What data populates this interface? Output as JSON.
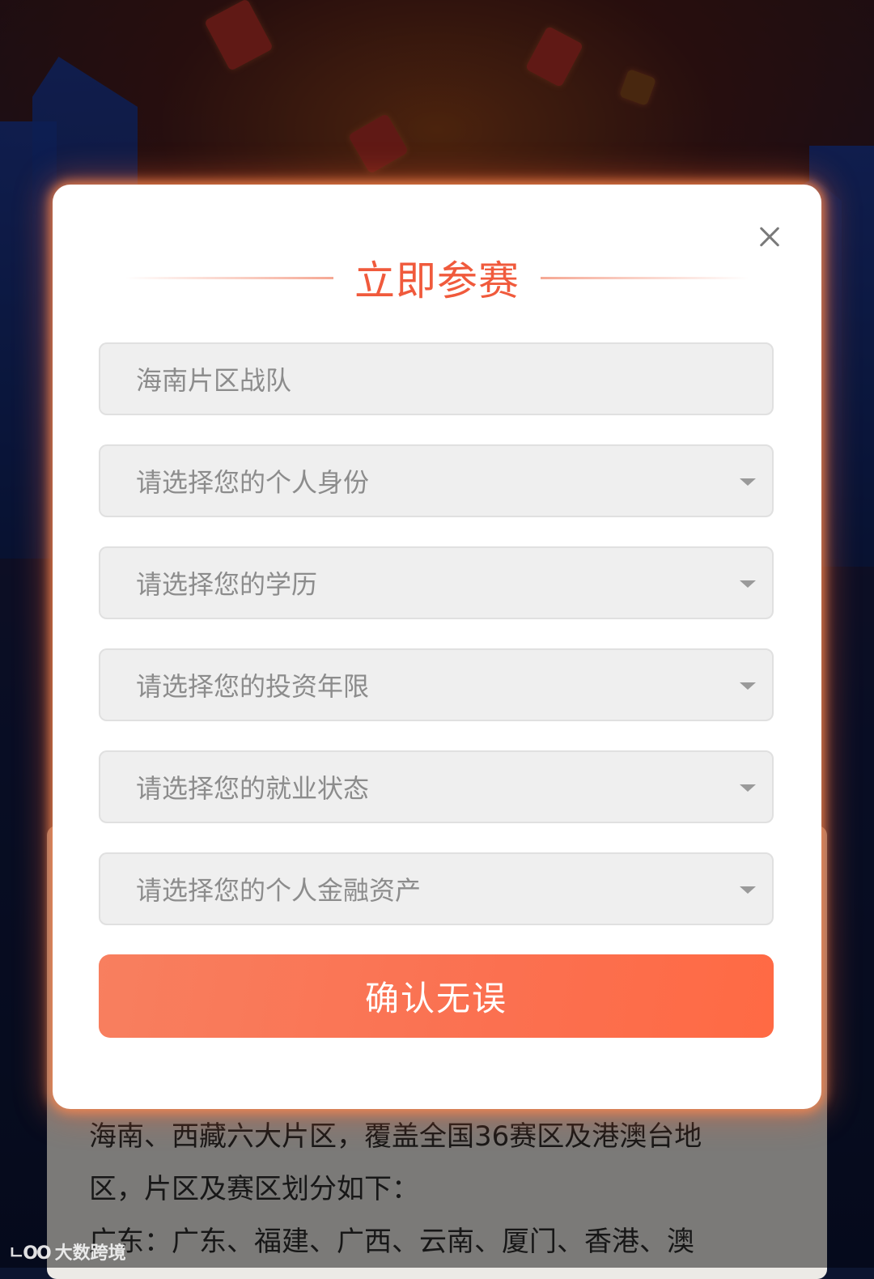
{
  "modal": {
    "title": "立即参赛",
    "close_icon": "close-icon",
    "team_field": {
      "value": "海南片区战队"
    },
    "selects": [
      {
        "placeholder": "请选择您的个人身份"
      },
      {
        "placeholder": "请选择您的学历"
      },
      {
        "placeholder": "请选择您的投资年限"
      },
      {
        "placeholder": "请选择您的就业状态"
      },
      {
        "placeholder": "请选择您的个人金融资产"
      }
    ],
    "submit_label": "确认无误",
    "accent_color": "#f05a3c",
    "button_color": "#fb7050"
  },
  "background": {
    "article_lines": [
      "海南、西藏六大片区，覆盖全国36赛区及港澳台地",
      "区，片区及赛区划分如下：",
      "广东：广东、福建、广西、云南、厦门、香港、澳"
    ]
  },
  "watermark": {
    "logo_text": "ㄴOO",
    "text": "大数跨境"
  }
}
